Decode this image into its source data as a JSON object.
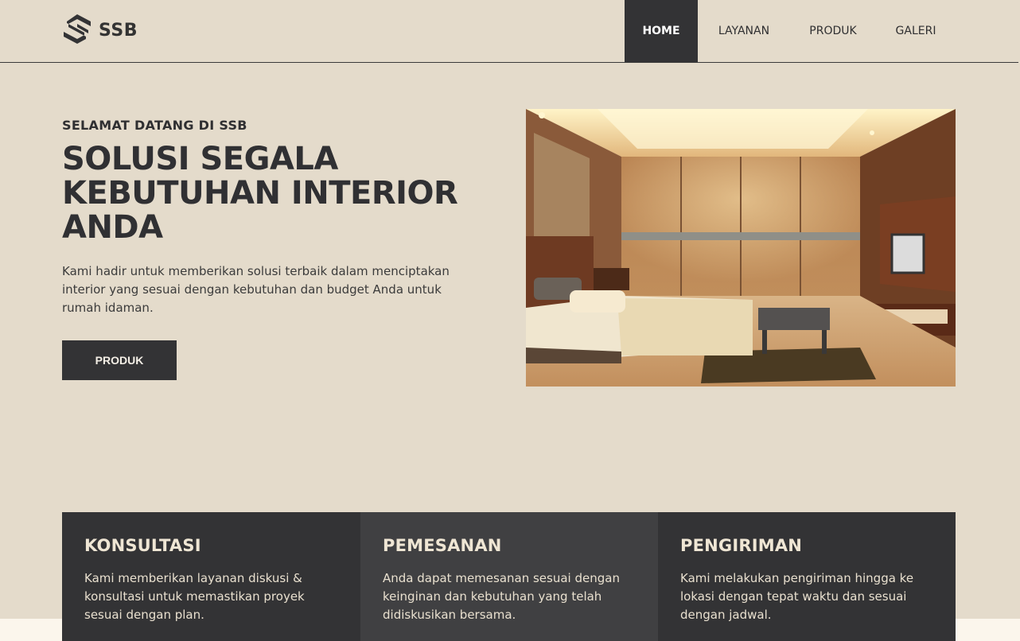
{
  "brand": {
    "name": "SSB"
  },
  "nav": {
    "items": [
      {
        "label": "HOME"
      },
      {
        "label": "LAYANAN"
      },
      {
        "label": "PRODUK"
      },
      {
        "label": "GALERI"
      }
    ],
    "active": "HOME"
  },
  "hero": {
    "eyebrow": "SELAMAT DATANG DI SSB",
    "title": "SOLUSI SEGALA KEBUTUHAN INTERIOR ANDA",
    "description": "Kami hadir untuk memberikan solusi terbaik dalam menciptakan interior yang sesuai dengan kebutuhan dan budget Anda untuk rumah idaman.",
    "button_label": "PRODUK"
  },
  "services": [
    {
      "title": "KONSULTASI",
      "description": "Kami memberikan layanan diskusi & konsultasi untuk memastikan proyek sesuai dengan plan."
    },
    {
      "title": "PEMESANAN",
      "description": "Anda dapat memesanan sesuai dengan keinginan dan kebutuhan yang telah didiskusikan bersama."
    },
    {
      "title": "PENGIRIMAN",
      "description": "Kami melakukan pengiriman hingga ke lokasi dengan tepat waktu dan sesuai dengan jadwal."
    }
  ],
  "colors": {
    "background": "#e4dbcb",
    "dark": "#333335",
    "dark_alt": "#404042",
    "accent_text": "#efe6d4"
  }
}
